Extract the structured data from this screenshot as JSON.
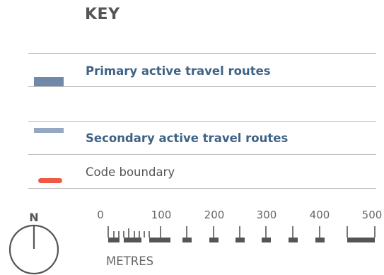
{
  "key": {
    "title": "KEY"
  },
  "legend": [
    {
      "label": "Primary active travel routes",
      "color": "#7189a9",
      "symbol": "thick-bar"
    },
    {
      "label": "Secondary active travel routes",
      "color": "#95a8c1",
      "symbol": "thin-bar"
    },
    {
      "label": "Code boundary",
      "color": "#f05a45",
      "symbol": "rounded-line"
    }
  ],
  "north_arrow": {
    "label": "N"
  },
  "scale_bar": {
    "units": "METRES",
    "ticks": [
      "0",
      "100",
      "200",
      "300",
      "400",
      "500"
    ],
    "color": "#555555"
  }
}
